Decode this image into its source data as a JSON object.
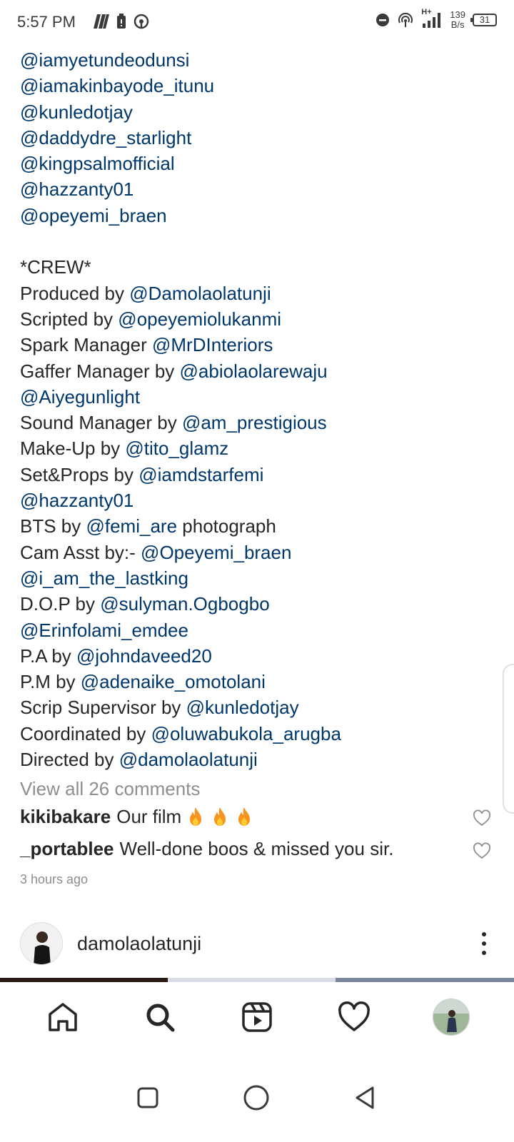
{
  "status_bar": {
    "time": "5:57 PM",
    "net_speed_value": "139",
    "net_speed_unit": "B/s",
    "battery": "31",
    "signal_label": "H+"
  },
  "caption": {
    "lines": [
      [
        {
          "t": "@iamyetundeodunsi",
          "m": true
        }
      ],
      [
        {
          "t": "@iamakinbayode_itunu",
          "m": true
        }
      ],
      [
        {
          "t": "@kunledotjay",
          "m": true
        }
      ],
      [
        {
          "t": "@daddydre_starlight",
          "m": true
        }
      ],
      [
        {
          "t": "@kingpsalmofficial",
          "m": true
        }
      ],
      [
        {
          "t": "@hazzanty01",
          "m": true
        }
      ],
      [
        {
          "t": "@opeyemi_braen",
          "m": true
        }
      ],
      [],
      [
        {
          "t": "*CREW*",
          "m": false
        }
      ],
      [
        {
          "t": "Produced by ",
          "m": false
        },
        {
          "t": "@Damolaolatunji",
          "m": true
        }
      ],
      [
        {
          "t": "Scripted by ",
          "m": false
        },
        {
          "t": "@opeyemiolukanmi",
          "m": true
        }
      ],
      [
        {
          "t": "Spark Manager ",
          "m": false
        },
        {
          "t": "@MrDInteriors",
          "m": true
        }
      ],
      [
        {
          "t": "Gaffer Manager by ",
          "m": false
        },
        {
          "t": "@abiolaolarewaju",
          "m": true
        }
      ],
      [
        {
          "t": "@Aiyegunlight",
          "m": true
        }
      ],
      [
        {
          "t": "Sound Manager by ",
          "m": false
        },
        {
          "t": "@am_prestigious",
          "m": true
        }
      ],
      [
        {
          "t": "Make-Up by ",
          "m": false
        },
        {
          "t": "@tito_glamz",
          "m": true
        }
      ],
      [
        {
          "t": "Set&Props by ",
          "m": false
        },
        {
          "t": "@iamdstarfemi",
          "m": true
        }
      ],
      [
        {
          "t": "@hazzanty01",
          "m": true
        }
      ],
      [
        {
          "t": "BTS by ",
          "m": false
        },
        {
          "t": "@femi_are",
          "m": true
        },
        {
          "t": " photograph",
          "m": false
        }
      ],
      [
        {
          "t": "Cam Asst by:- ",
          "m": false
        },
        {
          "t": "@Opeyemi_braen",
          "m": true
        }
      ],
      [
        {
          "t": "@i_am_the_lastking",
          "m": true
        }
      ],
      [
        {
          "t": "D.O.P by ",
          "m": false
        },
        {
          "t": "@sulyman.Ogbogbo",
          "m": true
        }
      ],
      [
        {
          "t": "@Erinfolami_emdee",
          "m": true
        }
      ],
      [
        {
          "t": "P.A by ",
          "m": false
        },
        {
          "t": "@johndaveed20",
          "m": true
        }
      ],
      [
        {
          "t": "P.M by ",
          "m": false
        },
        {
          "t": "@adenaike_omotolani",
          "m": true
        }
      ],
      [
        {
          "t": "Scrip Supervisor by ",
          "m": false
        },
        {
          "t": "@kunledotjay",
          "m": true
        }
      ],
      [
        {
          "t": "Coordinated by ",
          "m": false
        },
        {
          "t": "@oluwabukola_arugba",
          "m": true
        }
      ],
      [
        {
          "t": "Directed by ",
          "m": false
        },
        {
          "t": "@damolaolatunji",
          "m": true
        }
      ]
    ]
  },
  "view_all_comments": "View all 26 comments",
  "comments": [
    {
      "user": "kikibakare",
      "text": "Our film"
    },
    {
      "user": "_portablee",
      "text": "Well-done boos & missed you sir."
    }
  ],
  "time_ago": "3 hours ago",
  "next_post": {
    "username": "damolaolatunji"
  },
  "bottom_nav": [
    "home-icon",
    "search-icon",
    "reels-icon",
    "activity-heart-icon",
    "profile-avatar"
  ],
  "system_nav": [
    "recents-square-icon",
    "home-circle-icon",
    "back-triangle-icon"
  ],
  "colors": {
    "mention": "#00376b",
    "text": "#262626",
    "muted": "#8e8e8e",
    "fire": "#f7931e"
  }
}
